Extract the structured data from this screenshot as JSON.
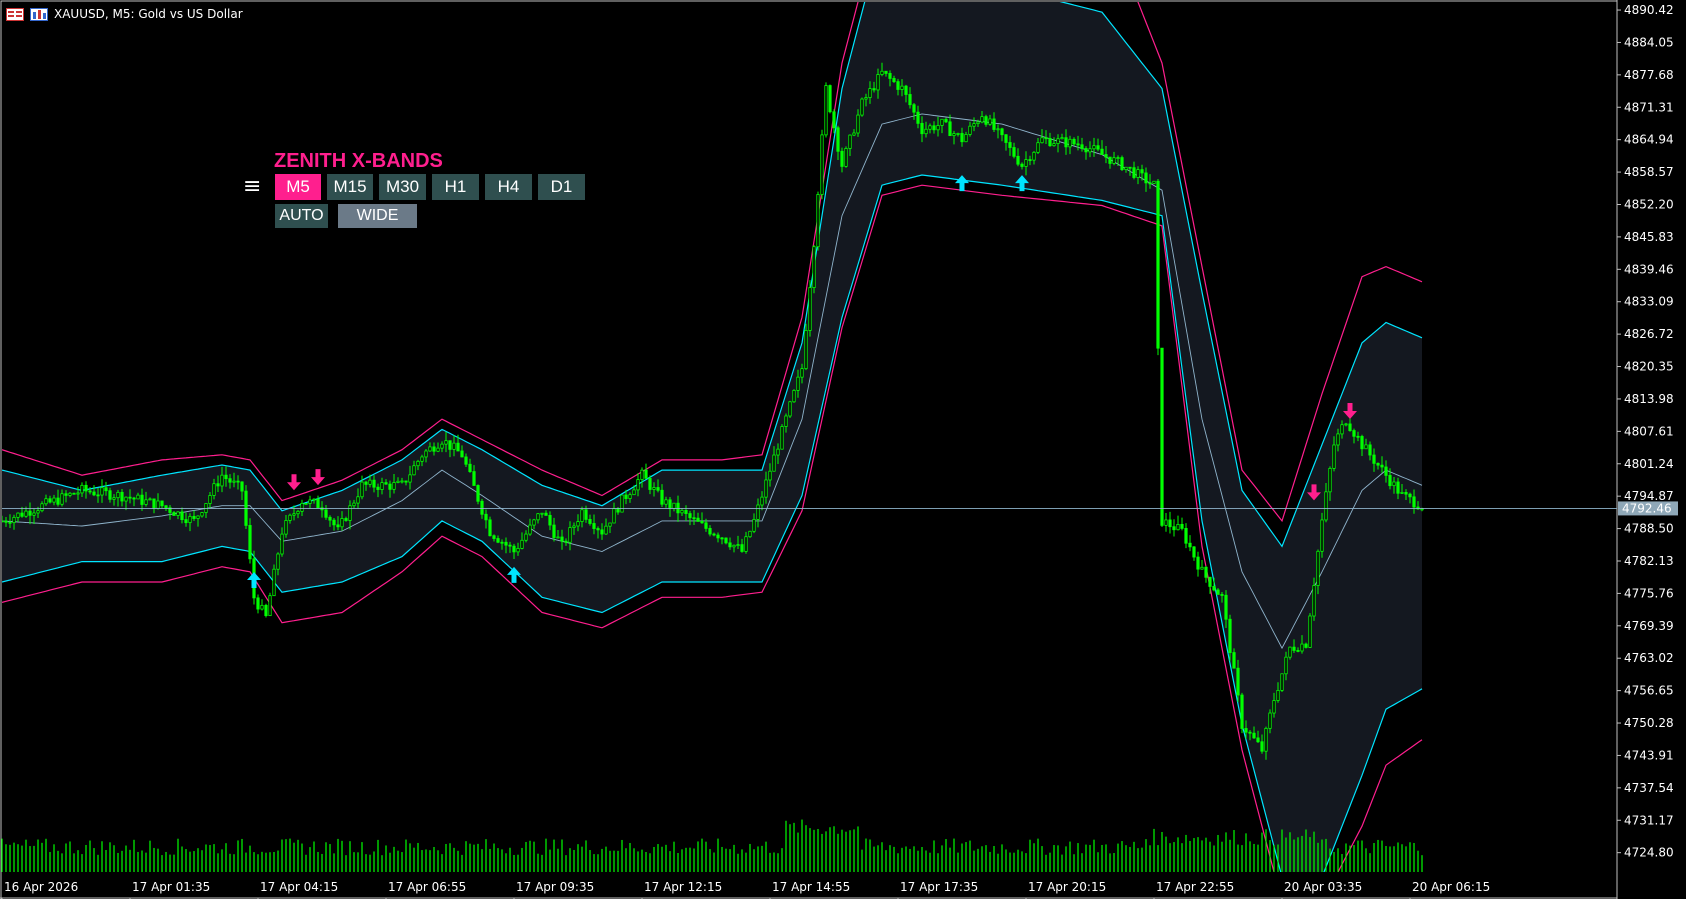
{
  "window": {
    "title": "XAUUSD, M5:  Gold vs US Dollar"
  },
  "indicator_panel": {
    "name": "ZENITH X-BANDS",
    "menu_glyph": "≡",
    "timeframes": [
      "M5",
      "M15",
      "M30",
      "H1",
      "H4",
      "D1"
    ],
    "active_timeframe": "M5",
    "mode_buttons": [
      "AUTO",
      "WIDE"
    ],
    "colors": {
      "accent": "#ff1f8e",
      "button": "#2f4f4f",
      "wide_button": "#6b7a88"
    }
  },
  "chart_data": {
    "type": "line",
    "title": "",
    "symbol": "XAUUSD",
    "timeframe": "M5",
    "y_ticks": [
      "4890.42",
      "4884.05",
      "4877.68",
      "4871.31",
      "4864.94",
      "4858.57",
      "4852.20",
      "4845.83",
      "4839.46",
      "4833.09",
      "4826.72",
      "4820.35",
      "4813.98",
      "4807.61",
      "4801.24",
      "4794.87",
      "4788.50",
      "4782.13",
      "4775.76",
      "4769.39",
      "4763.02",
      "4756.65",
      "4750.28",
      "4743.91",
      "4737.54",
      "4731.17",
      "4724.80"
    ],
    "ylim": [
      4721.0,
      4892.0
    ],
    "x_ticks": [
      "16 Apr 2026",
      "17 Apr 01:35",
      "17 Apr 04:15",
      "17 Apr 06:55",
      "17 Apr 09:35",
      "17 Apr 12:15",
      "17 Apr 14:55",
      "17 Apr 17:35",
      "17 Apr 20:15",
      "17 Apr 22:55",
      "20 Apr 03:35",
      "20 Apr 06:15"
    ],
    "x_tick_index": [
      0,
      32,
      64,
      96,
      128,
      160,
      192,
      224,
      256,
      288,
      320,
      352
    ],
    "n_bars": 356,
    "current_price": "4792.46",
    "price_series_color": "#00ff00",
    "band_colors": {
      "outer_upper": "#ff1f8e",
      "outer_lower_a": "#ff1f8e",
      "inner": "#00e5ff",
      "mid": "#8fb4cc",
      "fill": "#141820"
    },
    "price_path": [
      [
        0,
        4790
      ],
      [
        10,
        4793
      ],
      [
        20,
        4796
      ],
      [
        30,
        4795
      ],
      [
        40,
        4793
      ],
      [
        48,
        4790
      ],
      [
        55,
        4799
      ],
      [
        60,
        4796
      ],
      [
        63,
        4775
      ],
      [
        66,
        4771
      ],
      [
        70,
        4788
      ],
      [
        75,
        4794
      ],
      [
        80,
        4793
      ],
      [
        84,
        4788
      ],
      [
        90,
        4797
      ],
      [
        100,
        4797
      ],
      [
        105,
        4803
      ],
      [
        110,
        4806
      ],
      [
        115,
        4803
      ],
      [
        122,
        4788
      ],
      [
        128,
        4784
      ],
      [
        135,
        4792
      ],
      [
        140,
        4785
      ],
      [
        145,
        4792
      ],
      [
        150,
        4788
      ],
      [
        155,
        4794
      ],
      [
        160,
        4799
      ],
      [
        165,
        4794
      ],
      [
        175,
        4789
      ],
      [
        180,
        4787
      ],
      [
        185,
        4784
      ],
      [
        188,
        4790
      ],
      [
        192,
        4800
      ],
      [
        196,
        4810
      ],
      [
        200,
        4820
      ],
      [
        203,
        4845
      ],
      [
        206,
        4875
      ],
      [
        210,
        4860
      ],
      [
        215,
        4872
      ],
      [
        220,
        4878
      ],
      [
        225,
        4875
      ],
      [
        230,
        4867
      ],
      [
        235,
        4868
      ],
      [
        240,
        4865
      ],
      [
        245,
        4870
      ],
      [
        250,
        4865
      ],
      [
        255,
        4860
      ],
      [
        260,
        4865
      ],
      [
        270,
        4864
      ],
      [
        280,
        4860
      ],
      [
        288,
        4856
      ],
      [
        290,
        4790
      ],
      [
        295,
        4788
      ],
      [
        300,
        4780
      ],
      [
        305,
        4775
      ],
      [
        310,
        4750
      ],
      [
        315,
        4745
      ],
      [
        318,
        4755
      ],
      [
        322,
        4765
      ],
      [
        326,
        4766
      ],
      [
        330,
        4790
      ],
      [
        333,
        4805
      ],
      [
        336,
        4810
      ],
      [
        340,
        4805
      ],
      [
        345,
        4800
      ],
      [
        350,
        4795
      ],
      [
        355,
        4793
      ]
    ],
    "upper_outer": [
      [
        0,
        4804
      ],
      [
        20,
        4799
      ],
      [
        40,
        4802
      ],
      [
        55,
        4803
      ],
      [
        62,
        4802
      ],
      [
        70,
        4794
      ],
      [
        85,
        4798
      ],
      [
        100,
        4804
      ],
      [
        110,
        4810
      ],
      [
        120,
        4806
      ],
      [
        135,
        4800
      ],
      [
        150,
        4795
      ],
      [
        165,
        4802
      ],
      [
        180,
        4802
      ],
      [
        190,
        4803
      ],
      [
        200,
        4830
      ],
      [
        210,
        4880
      ],
      [
        220,
        4910
      ],
      [
        230,
        4910
      ],
      [
        250,
        4910
      ],
      [
        275,
        4910
      ],
      [
        290,
        4880
      ],
      [
        300,
        4840
      ],
      [
        310,
        4800
      ],
      [
        320,
        4790
      ],
      [
        330,
        4815
      ],
      [
        340,
        4838
      ],
      [
        346,
        4840
      ],
      [
        355,
        4837
      ]
    ],
    "upper_inner": [
      [
        0,
        4800
      ],
      [
        20,
        4796
      ],
      [
        40,
        4799
      ],
      [
        55,
        4801
      ],
      [
        62,
        4800
      ],
      [
        70,
        4792
      ],
      [
        85,
        4796
      ],
      [
        100,
        4802
      ],
      [
        110,
        4808
      ],
      [
        120,
        4804
      ],
      [
        135,
        4797
      ],
      [
        150,
        4793
      ],
      [
        165,
        4800
      ],
      [
        180,
        4800
      ],
      [
        190,
        4800
      ],
      [
        200,
        4825
      ],
      [
        210,
        4875
      ],
      [
        220,
        4905
      ],
      [
        230,
        4900
      ],
      [
        250,
        4895
      ],
      [
        275,
        4890
      ],
      [
        290,
        4875
      ],
      [
        300,
        4835
      ],
      [
        310,
        4796
      ],
      [
        320,
        4785
      ],
      [
        330,
        4805
      ],
      [
        340,
        4825
      ],
      [
        346,
        4829
      ],
      [
        355,
        4826
      ]
    ],
    "middle": [
      [
        0,
        4790
      ],
      [
        20,
        4789
      ],
      [
        40,
        4791
      ],
      [
        55,
        4793
      ],
      [
        62,
        4793
      ],
      [
        70,
        4786
      ],
      [
        85,
        4788
      ],
      [
        100,
        4794
      ],
      [
        110,
        4800
      ],
      [
        120,
        4795
      ],
      [
        135,
        4787
      ],
      [
        150,
        4784
      ],
      [
        165,
        4790
      ],
      [
        180,
        4790
      ],
      [
        190,
        4790
      ],
      [
        200,
        4810
      ],
      [
        210,
        4850
      ],
      [
        220,
        4868
      ],
      [
        230,
        4870
      ],
      [
        250,
        4868
      ],
      [
        275,
        4862
      ],
      [
        290,
        4855
      ],
      [
        300,
        4810
      ],
      [
        310,
        4780
      ],
      [
        320,
        4765
      ],
      [
        330,
        4780
      ],
      [
        340,
        4796
      ],
      [
        346,
        4800
      ],
      [
        355,
        4797
      ]
    ],
    "lower_inner": [
      [
        0,
        4778
      ],
      [
        20,
        4782
      ],
      [
        40,
        4782
      ],
      [
        55,
        4785
      ],
      [
        62,
        4784
      ],
      [
        70,
        4776
      ],
      [
        85,
        4778
      ],
      [
        100,
        4783
      ],
      [
        110,
        4790
      ],
      [
        120,
        4786
      ],
      [
        135,
        4775
      ],
      [
        150,
        4772
      ],
      [
        165,
        4778
      ],
      [
        180,
        4778
      ],
      [
        190,
        4778
      ],
      [
        200,
        4795
      ],
      [
        210,
        4830
      ],
      [
        220,
        4856
      ],
      [
        230,
        4858
      ],
      [
        250,
        4856
      ],
      [
        275,
        4853
      ],
      [
        290,
        4850
      ],
      [
        300,
        4790
      ],
      [
        310,
        4750
      ],
      [
        320,
        4720
      ],
      [
        330,
        4720
      ],
      [
        340,
        4740
      ],
      [
        346,
        4753
      ],
      [
        355,
        4757
      ]
    ],
    "lower_outer": [
      [
        0,
        4774
      ],
      [
        20,
        4778
      ],
      [
        40,
        4778
      ],
      [
        55,
        4781
      ],
      [
        62,
        4780
      ],
      [
        70,
        4770
      ],
      [
        85,
        4772
      ],
      [
        100,
        4780
      ],
      [
        110,
        4787
      ],
      [
        120,
        4783
      ],
      [
        135,
        4772
      ],
      [
        150,
        4769
      ],
      [
        165,
        4775
      ],
      [
        180,
        4775
      ],
      [
        190,
        4776
      ],
      [
        200,
        4792
      ],
      [
        210,
        4828
      ],
      [
        220,
        4854
      ],
      [
        230,
        4856
      ],
      [
        250,
        4854
      ],
      [
        275,
        4852
      ],
      [
        290,
        4848
      ],
      [
        300,
        4785
      ],
      [
        310,
        4745
      ],
      [
        320,
        4715
      ],
      [
        330,
        4715
      ],
      [
        340,
        4730
      ],
      [
        346,
        4742
      ],
      [
        355,
        4747
      ]
    ],
    "buy_arrows": [
      [
        63,
        4778
      ],
      [
        128,
        4779
      ],
      [
        240,
        4856
      ],
      [
        255,
        4856
      ]
    ],
    "sell_arrows": [
      [
        73,
        4798
      ],
      [
        79,
        4799
      ],
      [
        328,
        4796
      ],
      [
        337,
        4812
      ]
    ],
    "volume_max": 1.0
  }
}
